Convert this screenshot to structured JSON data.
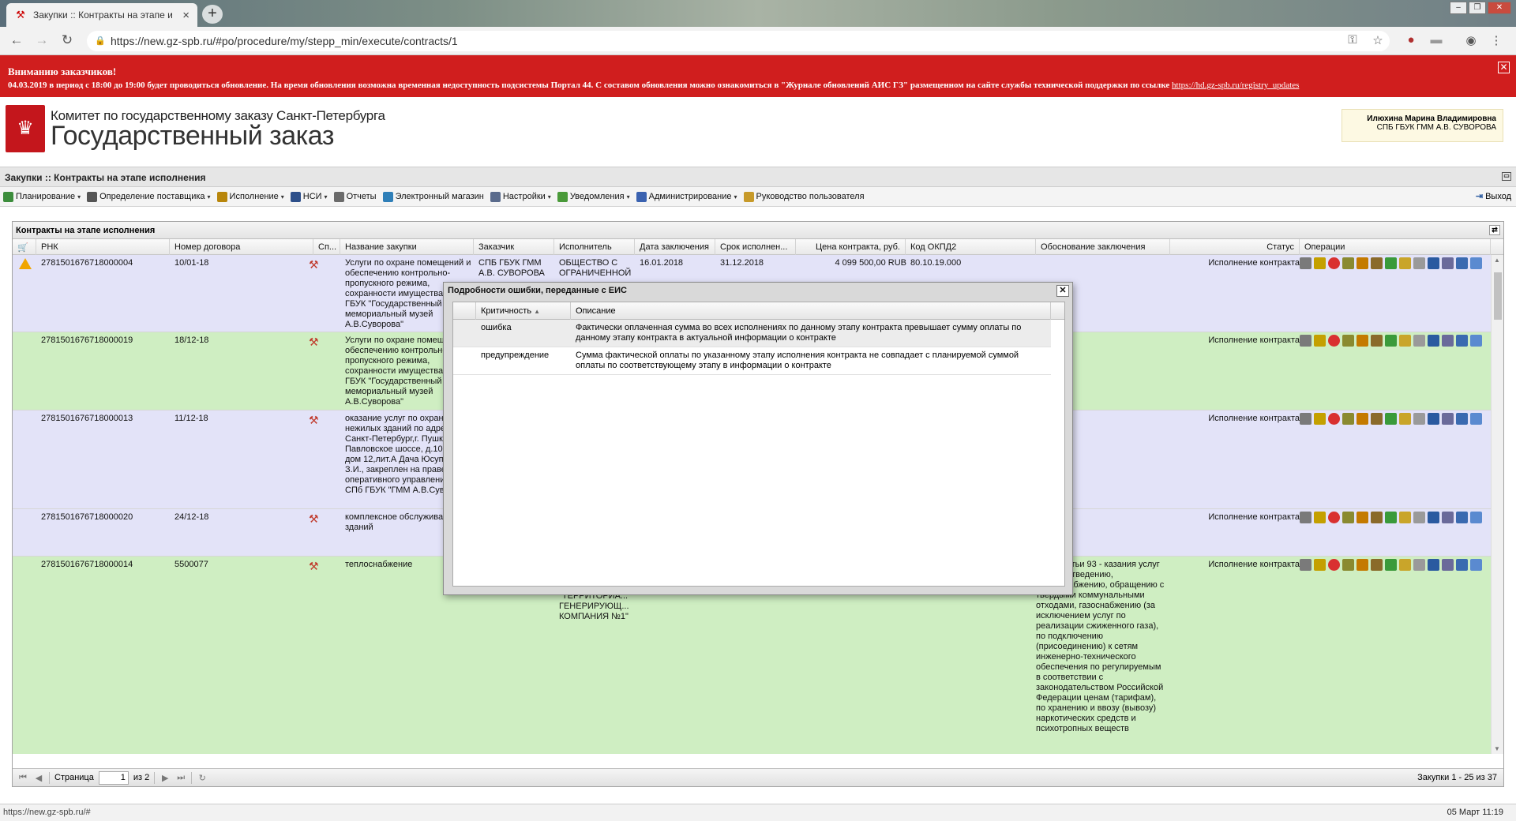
{
  "browser": {
    "tab_title": "Закупки :: Контракты на этапе и",
    "url": "https://new.gz-spb.ru/#po/procedure/my/stepp_min/execute/contracts/1"
  },
  "banner": {
    "heading": "Вниманию заказчиков!",
    "text": "04.03.2019 в период с 18:00 до 19:00 будет проводиться обновление. На время обновления возможна временная недоступность подсистемы Портал 44. С составом обновления можно ознакомиться в \"Журнале обновлений АИС ГЗ\" размещенном на сайте службы технической поддержки по ссылке",
    "link": "https://hd.gz-spb.ru/registry_updates"
  },
  "header": {
    "org_line1": "Комитет по государственному заказу Санкт-Петербурга",
    "org_line2": "Государственный заказ",
    "user_name": "Илюхина Марина Владимировна",
    "user_org": "СПБ ГБУК ГММ А.В. СУВОРОВА"
  },
  "section_title": "Закупки :: Контракты на этапе исполнения",
  "menu": [
    {
      "label": "Планирование",
      "icon": "planning-icon",
      "color": "#3c8d3c",
      "dropdown": true
    },
    {
      "label": "Определение поставщика",
      "icon": "supplier-icon",
      "color": "#555555",
      "dropdown": true
    },
    {
      "label": "Исполнение",
      "icon": "execution-icon",
      "color": "#b8860b",
      "dropdown": true
    },
    {
      "label": "НСИ",
      "icon": "reference-icon",
      "color": "#2d4f8a",
      "dropdown": true
    },
    {
      "label": "Отчеты",
      "icon": "reports-icon",
      "color": "#6b6b6b",
      "dropdown": false
    },
    {
      "label": "Электронный магазин",
      "icon": "shop-icon",
      "color": "#2f7fb8",
      "dropdown": false
    },
    {
      "label": "Настройки",
      "icon": "settings-icon",
      "color": "#5a6b8c",
      "dropdown": true
    },
    {
      "label": "Уведомления",
      "icon": "notifications-icon",
      "color": "#4a9a3a",
      "dropdown": true
    },
    {
      "label": "Администрирование",
      "icon": "admin-icon",
      "color": "#3a62b0",
      "dropdown": true
    },
    {
      "label": "Руководство пользователя",
      "icon": "manual-icon",
      "color": "#c79a2a",
      "dropdown": false
    }
  ],
  "exit_label": "Выход",
  "panel_title": "Контракты на этапе исполнения",
  "columns": [
    "РНК",
    "Номер договора",
    "Сп...",
    "Название закупки",
    "Заказчик",
    "Исполнитель",
    "Дата заключения",
    "Срок исполнен...",
    "Цена контракта, руб.",
    "Код ОКПД2",
    "Обоснование заключения",
    "Статус",
    "Операции"
  ],
  "rows": [
    {
      "warn": true,
      "color": "lavender",
      "rnk": "2781501676718000004",
      "num": "10/01-18",
      "name": "Услуги по охране помещений и обеспечению контрольно-пропускного режима, сохранности имущества С ГБУК \"Государственный мемориальный музей А.В.Суворова\"",
      "customer": "СПБ ГБУК ГММ А.В. СУВОРОВА",
      "executor": "ОБЩЕСТВО С ОГРАНИЧЕННОЙ",
      "date": "16.01.2018",
      "term": "31.12.2018",
      "price": "4 099 500,00 RUB",
      "okpd": "80.10.19.000",
      "basis": "",
      "status": "Исполнение контракта"
    },
    {
      "warn": false,
      "color": "green",
      "rnk": "2781501676718000019",
      "num": "18/12-18",
      "name": "Услуги по охране помещен и обеспечению контрольно пропускного режима, сохранности имущества С ГБУК \"Государственный мемориальный музей А.В.Суворова\"",
      "customer": "",
      "executor": "",
      "date": "",
      "term": "",
      "price": "",
      "okpd": "",
      "basis": "",
      "status": "Исполнение контракта"
    },
    {
      "warn": false,
      "color": "lavender",
      "rnk": "2781501676718000013",
      "num": "11/12-18",
      "name": "оказание услуг по охране нежилых зданий по адресу Санкт-Петербург,г. Пушкин Павловское шоссе, д.10, лит.А, дом 12,лит.А Дача Юсуповой З.И., закреплен на праве оперативного управления за СПб ГБУК \"ГММ А.В.Суворова\"",
      "customer": "",
      "executor": "",
      "date": "",
      "term": "",
      "price": "",
      "okpd": "",
      "basis": "",
      "status": "Исполнение контракта"
    },
    {
      "warn": false,
      "color": "lavender",
      "rnk": "2781501676718000020",
      "num": "24/12-18",
      "name": "комплексное обслуживани зданий",
      "customer": "",
      "executor": "",
      "date": "",
      "term": "",
      "price": "",
      "okpd": "",
      "basis": "",
      "status": "Исполнение контракта"
    },
    {
      "warn": false,
      "color": "green",
      "rnk": "2781501676718000014",
      "num": "5500077",
      "name": "теплоснабжение",
      "customer": "",
      "executor": "\"ТЕРРИТОРИА... ГЕНЕРИРУЮЩ... КОМПАНИЯ №1\"",
      "date": "",
      "term": "",
      "price": "",
      "okpd": "",
      "basis": "нкт 8 статьи 93 - казания услуг по водоотведению, теплоснабжению, обращению с твердыми коммунальными отходами, газоснабжению (за исключением услуг по реализации сжиженного газа), по подключению (присоединению) к сетям инженерно-технического обеспечения по регулируемым в соответствии с законодательством Российской Федерации ценам (тарифам), по хранению и ввозу (вывозу) наркотических средств и психотропных веществ",
      "status": "Исполнение контракта"
    }
  ],
  "pager": {
    "page_label": "Страница",
    "page_value": "1",
    "of_label": "из 2",
    "summary": "Закупки 1 - 25 из 37"
  },
  "dialog": {
    "title": "Подробности ошибки, переданные с ЕИС",
    "col_severity": "Критичность",
    "col_description": "Описание",
    "rows": [
      {
        "severity": "ошибка",
        "description": "Фактически оплаченная сумма во всех исполнениях по данному этапу контракта превышает сумму оплаты по данному этапу контракта в актуальной информации о контракте"
      },
      {
        "severity": "предупреждение",
        "description": "Сумма фактической оплаты по указанному этапу исполнения контракта не совпадает с планируемой суммой оплаты по соответствующему этапу в информации о контракте"
      }
    ]
  },
  "statusbar": {
    "hover_url": "https://new.gz-spb.ru/#",
    "datetime": "05 Март 11:19"
  },
  "op_icon_colors": [
    "#7a7a7a",
    "#c4a000",
    "#d93030",
    "#8a8a30",
    "#c47a00",
    "#8a6a2a",
    "#3a9a3a",
    "#c9a52a",
    "#9a9a9a",
    "#2a5aa0",
    "#6a6a9a",
    "#3a6ab0",
    "#5a8ad0"
  ]
}
